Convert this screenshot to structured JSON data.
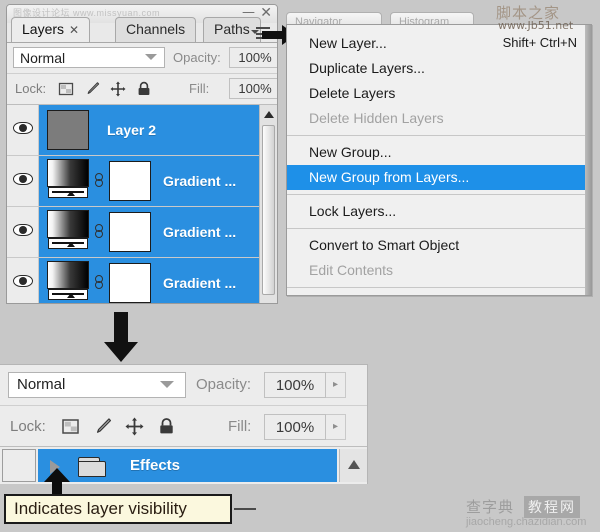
{
  "watermarks": {
    "top": "图像设计论坛  www.missyuan.com",
    "bottom_cn": "查字典",
    "bottom_badge": "教程网",
    "bottom_url": "jiaocheng.chazidian.com",
    "menu_cn": "脚本之家",
    "menu_url": "www.Jb51.net"
  },
  "layers_panel": {
    "minimize_label": "—",
    "close_label": "✕",
    "tabs": [
      {
        "label": "Layers",
        "close": "✕",
        "active": true
      },
      {
        "label": "Channels",
        "close": "",
        "active": false
      },
      {
        "label": "Paths",
        "close": "",
        "active": false
      }
    ],
    "blend_mode": "Normal",
    "opacity_label": "Opacity:",
    "opacity_value": "100%",
    "stepper_glyph": "▸",
    "lock_label": "Lock:",
    "lock_icons": [
      "lock-transparent-pixels-icon",
      "lock-image-pixels-icon",
      "lock-position-icon",
      "lock-all-icon"
    ],
    "fill_label": "Fill:",
    "fill_value": "100%",
    "layers": [
      {
        "name": "Layer 2",
        "type": "plain",
        "selected": true,
        "visible": true
      },
      {
        "name": "Gradient ...",
        "type": "gradient-mask",
        "selected": true,
        "visible": true
      },
      {
        "name": "Gradient ...",
        "type": "gradient-mask",
        "selected": true,
        "visible": true
      },
      {
        "name": "Gradient ...",
        "type": "gradient-mask",
        "selected": true,
        "visible": true
      }
    ]
  },
  "flyout_menu": {
    "background_tabs": [
      {
        "label": "Navigator"
      },
      {
        "label": "Histogram"
      }
    ],
    "items": [
      {
        "label": "New Layer...",
        "shortcut": "Shift+ Ctrl+N",
        "state": "normal"
      },
      {
        "label": "Duplicate Layers...",
        "shortcut": "",
        "state": "normal"
      },
      {
        "label": "Delete Layers",
        "shortcut": "",
        "state": "normal"
      },
      {
        "label": "Delete Hidden Layers",
        "shortcut": "",
        "state": "disabled"
      },
      {
        "label": "__SEP__",
        "shortcut": "",
        "state": "separator"
      },
      {
        "label": "New Group...",
        "shortcut": "",
        "state": "normal"
      },
      {
        "label": "New Group from Layers...",
        "shortcut": "",
        "state": "highlighted"
      },
      {
        "label": "__SEP__",
        "shortcut": "",
        "state": "separator"
      },
      {
        "label": "Lock Layers...",
        "shortcut": "",
        "state": "normal"
      },
      {
        "label": "__SEP__",
        "shortcut": "",
        "state": "separator"
      },
      {
        "label": "Convert to Smart Object",
        "shortcut": "",
        "state": "normal"
      },
      {
        "label": "Edit Contents",
        "shortcut": "",
        "state": "disabled"
      },
      {
        "label": "__SEP__",
        "shortcut": "",
        "state": "separator"
      }
    ]
  },
  "bottom_panel": {
    "blend_mode": "Normal",
    "opacity_label": "Opacity:",
    "opacity_value": "100%",
    "stepper_glyph": "▸",
    "lock_label": "Lock:",
    "fill_label": "Fill:",
    "fill_value": "100%",
    "group_row": {
      "name": "Effects",
      "disclosure_icon": "triangle-right-icon",
      "folder_icon": "folder-icon",
      "visibility_toggle": "eye-toggle-off"
    }
  },
  "tooltip": {
    "text": "Indicates layer visibility"
  },
  "colors": {
    "selection_blue": "#2a8fe0",
    "menu_highlight_blue": "#1e90e8",
    "panel_gray": "#ececec",
    "page_background": "#c8c8c8",
    "tooltip_yellow": "#fbf8de"
  }
}
